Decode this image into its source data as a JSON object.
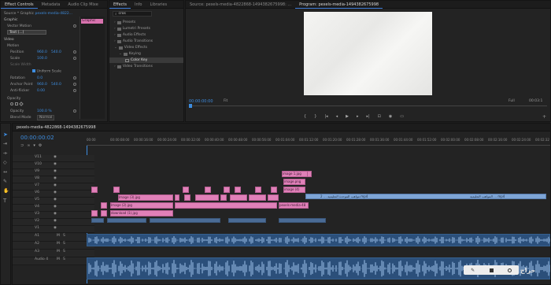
{
  "effect_controls": {
    "tabs": [
      {
        "label": "Effect Controls",
        "active": true
      },
      {
        "label": "Metadata",
        "active": false
      },
      {
        "label": "Audio Clip Mixe",
        "active": false
      }
    ],
    "source_row": "Source * Graphic",
    "sequence_ref": "pexels-media-4822...",
    "mini_clip_label": "Graphic",
    "sections": {
      "graphic": "Graphic",
      "vector_motion": "Vector Motion",
      "text": "Text (...)",
      "video": "Video",
      "motion": "Motion",
      "position": "Position",
      "scale": "Scale",
      "scale_width": "Scale Width",
      "uniform_scale": "Uniform Scale",
      "rotation": "Rotation",
      "anchor_point": "Anchor Point",
      "anti_flicker": "Anti-flicker",
      "opacity": "Opacity",
      "opacity2": "Opacity",
      "blend_mode": "Blend Mode"
    },
    "values": {
      "position_x": "960.0",
      "position_y": "540.0",
      "scale": "100.0",
      "rotation": "0.0",
      "anchor_x": "960.0",
      "anchor_y": "540.0",
      "anti_flicker": "0.00",
      "opacity": "100.0 %",
      "blend_mode": "Normal"
    }
  },
  "effects_panel": {
    "tabs": [
      {
        "label": "Effects",
        "active": true
      },
      {
        "label": "Info",
        "active": false
      },
      {
        "label": "Libraries",
        "active": false
      }
    ],
    "search_value": "cros",
    "items": [
      {
        "label": "Presets",
        "indent": 0
      },
      {
        "label": "Lumetri Presets",
        "indent": 0
      },
      {
        "label": "Audio Effects",
        "indent": 0
      },
      {
        "label": "Audio Transitions",
        "indent": 0
      },
      {
        "label": "Video Effects",
        "indent": 0
      },
      {
        "label": "Keying",
        "indent": 1
      },
      {
        "label": "Color Key",
        "indent": 2
      },
      {
        "label": "Video Transitions",
        "indent": 0
      }
    ]
  },
  "program_monitor": {
    "source_tab": "Source: pexels-media-4822868-1494382675998: ...",
    "program_tab": "Program: pexels-media-1494382675998",
    "timecode": "00:00:00:00",
    "fit_label": "Fit",
    "quality_label": "Full",
    "end_timecode": "00:03:1"
  },
  "timeline": {
    "sequence_name": "pexels-media-4822868-1494382675998",
    "timecode": "00:00:00:02",
    "ruler_labels": [
      "00:00",
      "00:00:08:00",
      "00:00:16:00",
      "00:00:24:00",
      "00:00:32:00",
      "00:00:40:00",
      "00:00:48:00",
      "00:00:56:00",
      "00:01:04:00",
      "00:01:12:00",
      "00:01:20:00",
      "00:01:28:00",
      "00:01:36:00",
      "00:01:44:00",
      "00:01:52:00",
      "00:02:00:00",
      "00:02:08:00",
      "00:02:16:00",
      "00:02:24:00",
      "00:02:32"
    ],
    "video_tracks": [
      "V11",
      "V10",
      "V9",
      "V8",
      "V7",
      "V6",
      "V5",
      "V4",
      "V3",
      "V2",
      "V1"
    ],
    "audio_tracks": [
      "A1",
      "A2",
      "A3",
      "Audio 4"
    ],
    "master_label": "Mix",
    "clip_labels": {
      "image1": "Image (3).jpg",
      "image2": "Image (2).jpg",
      "download": "download (1).jpg",
      "image_small": "image (4)",
      "image_png": "image.png",
      "main_blue": "مواهب الموحدة التعليمية … 2.mp4",
      "main_blue2": "المواهب التعليمية … mp4",
      "pexels": "pexels-media-48",
      "right_pink": "image 1.jpg",
      "right_pink2": "image 2.jpg"
    }
  },
  "watermark_text": "حراج"
}
